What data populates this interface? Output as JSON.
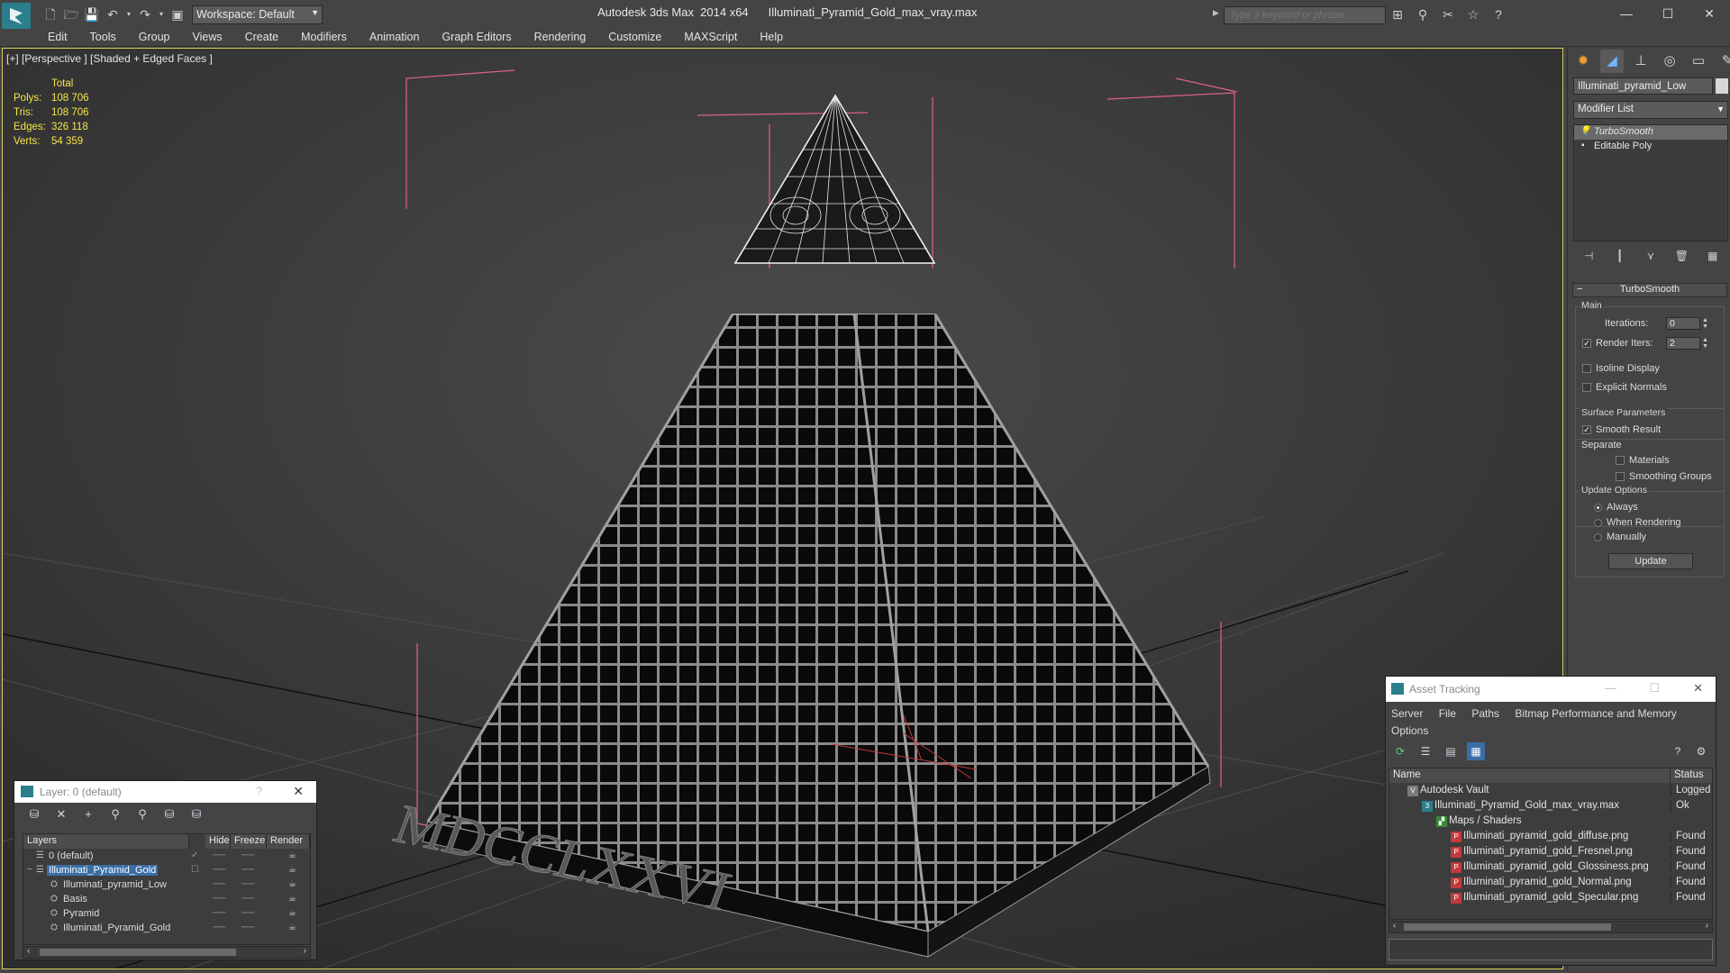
{
  "app": {
    "title": "Autodesk 3ds Max  2014 x64",
    "file": "Illuminati_Pyramid_Gold_max_vray.max",
    "workspace": "Workspace: Default",
    "search_placeholder": "Type a keyword or phrase",
    "quick_access_icons": [
      "new-icon",
      "open-icon",
      "save-icon",
      "undo-icon",
      "redo-icon",
      "project-folder-icon"
    ],
    "info_icons": [
      "binoculars-icon",
      "search-icon",
      "favorites-icon",
      "star-icon",
      "help-icon"
    ],
    "window_controls": [
      "—",
      "☐",
      "✕"
    ]
  },
  "menu": [
    "Edit",
    "Tools",
    "Group",
    "Views",
    "Create",
    "Modifiers",
    "Animation",
    "Graph Editors",
    "Rendering",
    "Customize",
    "MAXScript",
    "Help"
  ],
  "viewport": {
    "label": "[+] [Perspective ] [Shaded + Edged Faces ]",
    "stats_header": "Total",
    "stats": [
      {
        "key": "Polys:",
        "value": "108 706"
      },
      {
        "key": "Tris:",
        "value": "108 706"
      },
      {
        "key": "Edges:",
        "value": "326 118"
      },
      {
        "key": "Verts:",
        "value": "54 359"
      }
    ],
    "inscription": "MDCCLXXVI"
  },
  "command_panel": {
    "tabs": [
      "create-icon",
      "modify-icon",
      "hierarchy-icon",
      "motion-icon",
      "display-icon",
      "utilities-icon"
    ],
    "object_name": "Illuminati_pyramid_Low",
    "modifier_list": "Modifier List",
    "stack": [
      {
        "label": "TurboSmooth",
        "selected": true
      },
      {
        "label": "Editable Poly",
        "selected": false
      }
    ],
    "rollout_title": "TurboSmooth",
    "main_group": "Main",
    "iterations_label": "Iterations:",
    "iterations_value": "0",
    "render_iters_label": "Render Iters:",
    "render_iters_value": "2",
    "isoline_display": "Isoline Display",
    "explicit_normals": "Explicit Normals",
    "surface_group": "Surface Parameters",
    "smooth_result": "Smooth Result",
    "separate_label": "Separate",
    "materials": "Materials",
    "smoothing_groups": "Smoothing Groups",
    "update_group": "Update Options",
    "always": "Always",
    "when_rendering": "When Rendering",
    "manually": "Manually",
    "update_button": "Update"
  },
  "layer_dialog": {
    "title": "Layer: 0 (default)",
    "help": "?",
    "close": "✕",
    "columns": [
      "Layers",
      "Hide",
      "Freeze",
      "Render"
    ],
    "rows": [
      {
        "name": "0 (default)",
        "indent": 0,
        "selected": false,
        "check": "✓"
      },
      {
        "name": "Illuminati_Pyramid_Gold",
        "indent": 0,
        "selected": true,
        "check": "☐"
      },
      {
        "name": "Illuminati_pyramid_Low",
        "indent": 1,
        "selected": false,
        "check": ""
      },
      {
        "name": "Basis",
        "indent": 1,
        "selected": false,
        "check": ""
      },
      {
        "name": "Pyramid",
        "indent": 1,
        "selected": false,
        "check": ""
      },
      {
        "name": "Illuminati_Pyramid_Gold",
        "indent": 1,
        "selected": false,
        "check": ""
      }
    ]
  },
  "asset_dialog": {
    "title": "Asset Tracking",
    "menu": [
      "Server",
      "File",
      "Paths",
      "Bitmap Performance and Memory",
      "Options"
    ],
    "columns": [
      "Name",
      "Status"
    ],
    "rows": [
      {
        "name": "Autodesk Vault",
        "status": "Logged",
        "indent": 0,
        "icon": "vault"
      },
      {
        "name": "Illuminati_Pyramid_Gold_max_vray.max",
        "status": "Ok",
        "indent": 1,
        "icon": "max"
      },
      {
        "name": "Maps / Shaders",
        "status": "",
        "indent": 2,
        "icon": "maps"
      },
      {
        "name": "Illuminati_pyramid_gold_diffuse.png",
        "status": "Found",
        "indent": 3,
        "icon": "png"
      },
      {
        "name": "Illuminati_pyramid_gold_Fresnel.png",
        "status": "Found",
        "indent": 3,
        "icon": "png"
      },
      {
        "name": "Illuminati_pyramid_gold_Glossiness.png",
        "status": "Found",
        "indent": 3,
        "icon": "png"
      },
      {
        "name": "Illuminati_pyramid_gold_Normal.png",
        "status": "Found",
        "indent": 3,
        "icon": "png"
      },
      {
        "name": "Illuminati_pyramid_gold_Specular.png",
        "status": "Found",
        "indent": 3,
        "icon": "png"
      }
    ]
  },
  "colors": {
    "accent_yellow": "#f4e54a",
    "selection": "#3a6ea5",
    "bbox_pink": "#e0608a"
  }
}
